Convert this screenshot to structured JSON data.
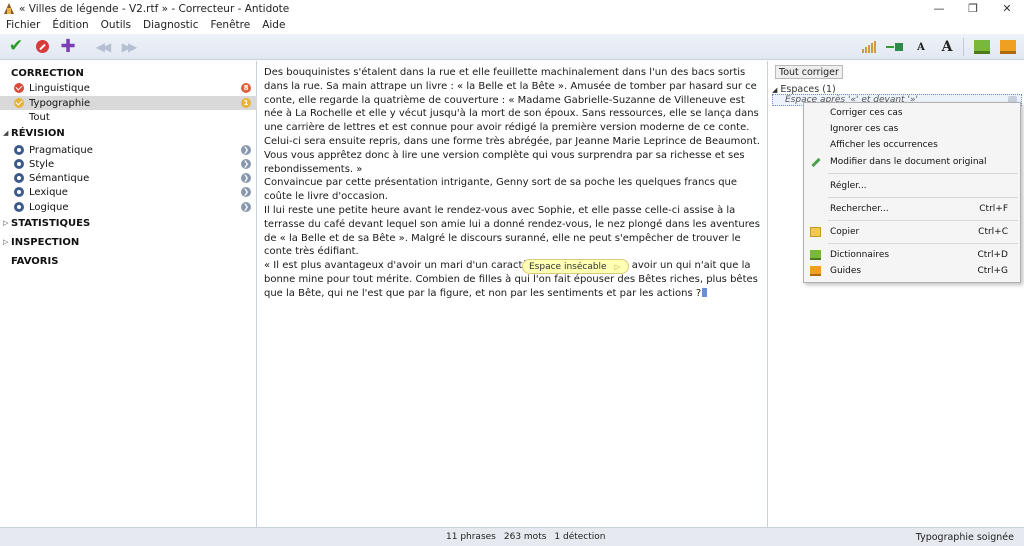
{
  "window": {
    "title": "« Villes de légende - V2.rtf » - Correcteur - Antidote",
    "minimize": "—",
    "restore": "❐",
    "close": "✕"
  },
  "menu": [
    "Fichier",
    "Édition",
    "Outils",
    "Diagnostic",
    "Fenêtre",
    "Aide"
  ],
  "left_panel": {
    "correction": {
      "title": "CORRECTION",
      "items": [
        {
          "label": "Linguistique",
          "badge": "8"
        },
        {
          "label": "Typographie",
          "badge": "1"
        },
        {
          "label": "Tout"
        }
      ]
    },
    "revision": {
      "title": "RÉVISION",
      "items": [
        {
          "label": "Pragmatique"
        },
        {
          "label": "Style"
        },
        {
          "label": "Sémantique"
        },
        {
          "label": "Lexique"
        },
        {
          "label": "Logique"
        }
      ]
    },
    "statistiques": "STATISTIQUES",
    "inspection": "INSPECTION",
    "favoris": "FAVORIS"
  },
  "document": {
    "paragraphs": [
      "Des bouquinistes s'étalent dans la rue et elle feuillette machinalement dans l'un des bacs sortis dans la rue. Sa main attrape un livre : « la Belle et la Bête ». Amusée de tomber par hasard sur ce conte, elle regarde la quatrième de couverture : « Madame Gabrielle-Suzanne de Villeneuve est née à La Rochelle et elle y vécut jusqu'à la mort de son époux. Sans ressources, elle se lança dans une carrière de lettres et est connue pour avoir rédigé la première version moderne de ce conte. Celui-ci sera ensuite repris, dans une forme très abrégée, par Jeanne Marie Leprince de Beaumont. Vous vous apprêtez donc à lire une version complète qui vous surprendra par sa richesse et ses rebondissements. »",
      "Convaincue par cette présentation intrigante, Genny sort de sa poche les quelques francs que coûte le livre d'occasion.",
      "Il lui reste une petite heure avant le rendez-vous avec Sophie, et elle passe celle-ci assise à la terrasse du café devant lequel son amie lui a donné rendez-vous, le nez plongé dans les aventures de « la Belle et de sa Bête ». Malgré le discours suranné, elle ne peut s'empêcher de trouver le conte très édifiant.",
      "« Il est plus avantageux d'avoir un mari d'un caractère aimable que d'en avoir un qui n'ait que la bonne mine pour tout mérite. Combien de filles à qui l'on fait épouser des Bêtes riches, plus bêtes que la Bête, qui ne l'est que par la figure, et non par les sentiments et par les actions ?"
    ],
    "tooltip": "Espace insécable"
  },
  "right_panel": {
    "fix_all": "Tout corriger",
    "group": "Espaces",
    "group_count": "(1)",
    "detection": "Espace après '«' et devant '»'"
  },
  "context_menu": [
    {
      "label": "Corriger ces cas"
    },
    {
      "label": "Ignorer ces cas"
    },
    {
      "label": "Afficher les occurrences"
    },
    {
      "label": "Modifier dans le document original"
    },
    {
      "label": "Régler..."
    },
    {
      "label": "Rechercher...",
      "shortcut": "Ctrl+F"
    },
    {
      "label": "Copier",
      "shortcut": "Ctrl+C"
    },
    {
      "label": "Dictionnaires",
      "shortcut": "Ctrl+D"
    },
    {
      "label": "Guides",
      "shortcut": "Ctrl+G"
    }
  ],
  "status": {
    "phrases": "11 phrases",
    "mots": "263 mots",
    "detections": "1 détection",
    "right": "Typographie soignée"
  },
  "icons": {
    "app": "antidote-icon",
    "accent_green": "#2a9a2a",
    "accent_red": "#d93a3a",
    "accent_purple": "#7a3fb5"
  }
}
